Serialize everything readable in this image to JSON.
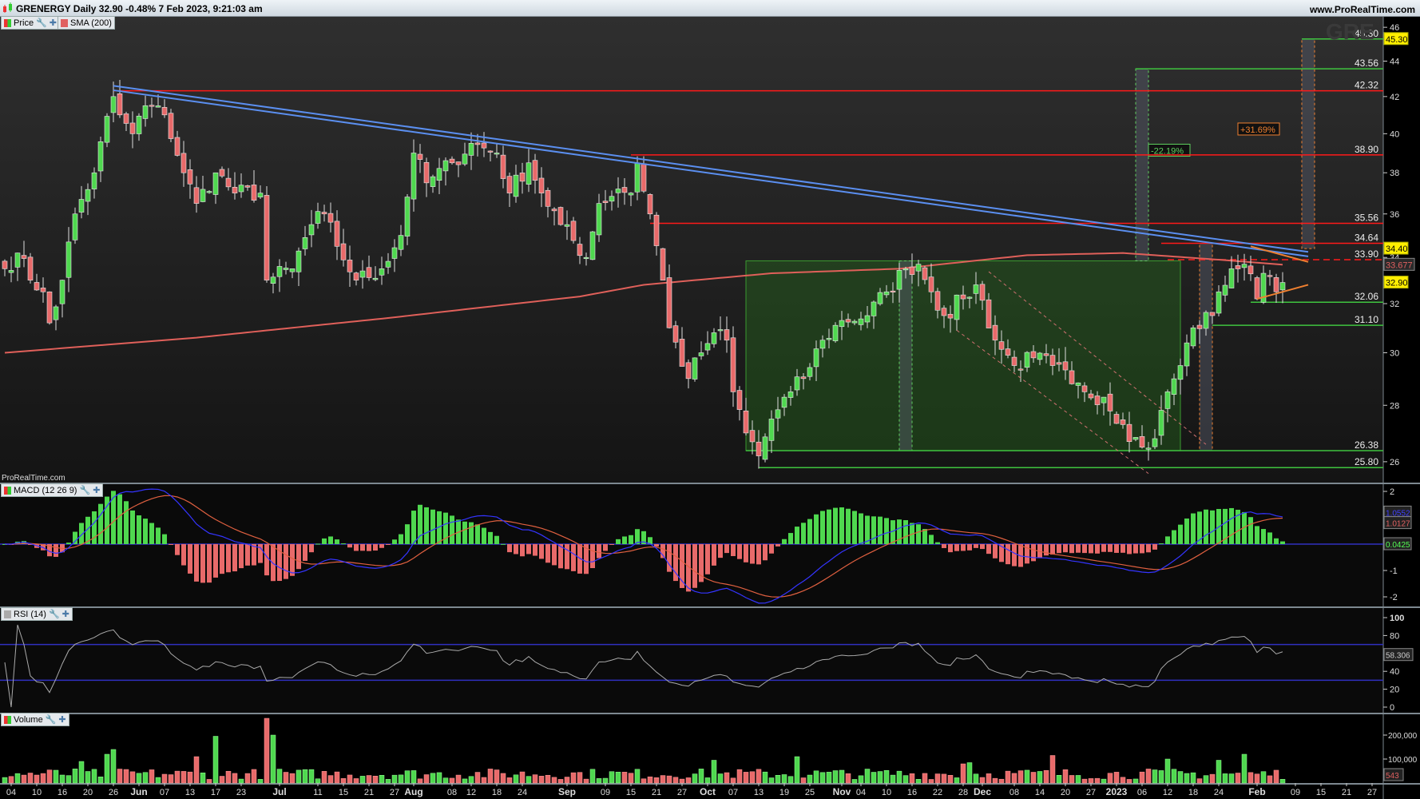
{
  "header": {
    "title": "GRENERGY Daily 32.90 -0.48% 7 Feb 2023, 9:21:03 am",
    "website": "www.ProRealTime.com"
  },
  "legends": {
    "price": "Price",
    "sma": "SMA (200)",
    "macd": "MACD (12 26 9)",
    "rsi": "RSI (14)",
    "volume": "Volume"
  },
  "watermark": "GRE",
  "brand_footer": "ProRealTime.com",
  "colors": {
    "up": "#4fd84f",
    "down": "#e86a6a",
    "sma": "#e0605a",
    "trend": "#5b8ff0",
    "hline_red": "#ff1a1a",
    "hline_green": "#3fc43f",
    "orange": "#f08030",
    "macd": "#3434ff",
    "signal": "#e06040"
  },
  "chart_data": {
    "type": "candlestick",
    "title": "GRENERGY Daily",
    "scale": "log",
    "ylim": [
      25.5,
      46.5
    ],
    "y_ticks": [
      "46",
      "44",
      "42",
      "40",
      "38",
      "36",
      "34",
      "32",
      "30",
      "28",
      "26"
    ],
    "close_keypoints": [
      [
        0,
        33.5
      ],
      [
        2,
        34.2
      ],
      [
        4,
        33.0
      ],
      [
        6,
        32.5
      ],
      [
        7,
        31.2
      ],
      [
        9,
        33.0
      ],
      [
        11,
        36.0
      ],
      [
        14,
        38.0
      ],
      [
        17,
        42.0
      ],
      [
        18,
        41.0
      ],
      [
        20,
        40.0
      ],
      [
        22,
        41.5
      ],
      [
        25,
        41.0
      ],
      [
        28,
        38.0
      ],
      [
        30,
        36.5
      ],
      [
        33,
        38.0
      ],
      [
        36,
        37.0
      ],
      [
        40,
        37.0
      ],
      [
        41,
        33.0
      ],
      [
        45,
        33.5
      ],
      [
        48,
        35.5
      ],
      [
        50,
        36.0
      ],
      [
        52,
        34.5
      ],
      [
        55,
        33.0
      ],
      [
        59,
        33.5
      ],
      [
        62,
        35.0
      ],
      [
        64,
        39.0
      ],
      [
        66,
        37.5
      ],
      [
        70,
        38.5
      ],
      [
        73,
        39.5
      ],
      [
        77,
        39.0
      ],
      [
        79,
        37.0
      ],
      [
        82,
        38.5
      ],
      [
        84,
        37.0
      ],
      [
        87,
        35.5
      ],
      [
        91,
        34.0
      ],
      [
        93,
        36.5
      ],
      [
        96,
        37.2
      ],
      [
        98,
        37.0
      ],
      [
        99,
        38.5
      ],
      [
        101,
        36.0
      ],
      [
        103,
        33.0
      ],
      [
        104,
        31.0
      ],
      [
        107,
        29.0
      ],
      [
        109,
        30.0
      ],
      [
        111,
        30.8
      ],
      [
        113,
        30.5
      ],
      [
        114,
        28.5
      ],
      [
        116,
        27.0
      ],
      [
        118,
        26.2
      ],
      [
        120,
        27.5
      ],
      [
        123,
        28.5
      ],
      [
        125,
        29.0
      ],
      [
        128,
        30.5
      ],
      [
        131,
        31.3
      ],
      [
        135,
        31.5
      ],
      [
        138,
        32.5
      ],
      [
        141,
        33.5
      ],
      [
        143,
        33.7
      ],
      [
        145,
        32.5
      ],
      [
        147,
        31.5
      ],
      [
        150,
        32.2
      ],
      [
        152,
        32.8
      ],
      [
        155,
        30.5
      ],
      [
        158,
        29.5
      ],
      [
        161,
        29.8
      ],
      [
        164,
        29.5
      ],
      [
        167,
        28.8
      ],
      [
        169,
        28.5
      ],
      [
        172,
        28.3
      ],
      [
        175,
        27.3
      ],
      [
        178,
        26.5
      ],
      [
        180,
        26.8
      ],
      [
        182,
        28.5
      ],
      [
        184,
        29.5
      ],
      [
        186,
        31.0
      ],
      [
        189,
        31.5
      ],
      [
        190,
        32.5
      ],
      [
        192,
        33.5
      ],
      [
        194,
        33.7
      ],
      [
        196,
        32.2
      ],
      [
        197,
        33.3
      ],
      [
        198,
        33.2
      ],
      [
        199,
        32.5
      ],
      [
        200,
        32.9
      ]
    ],
    "sma200_keypoints": [
      [
        0,
        30.0
      ],
      [
        30,
        30.6
      ],
      [
        60,
        31.4
      ],
      [
        90,
        32.3
      ],
      [
        100,
        32.8
      ],
      [
        120,
        33.3
      ],
      [
        140,
        33.5
      ],
      [
        160,
        34.1
      ],
      [
        175,
        34.2
      ],
      [
        190,
        33.9
      ],
      [
        200,
        33.68
      ]
    ],
    "x_labels": [
      {
        "i": 1,
        "t": "04"
      },
      {
        "i": 5,
        "t": "10"
      },
      {
        "i": 9,
        "t": "16"
      },
      {
        "i": 13,
        "t": "20"
      },
      {
        "i": 17,
        "t": "26"
      },
      {
        "i": 21,
        "t": "Jun",
        "b": 1
      },
      {
        "i": 25,
        "t": "07"
      },
      {
        "i": 29,
        "t": "13"
      },
      {
        "i": 33,
        "t": "17"
      },
      {
        "i": 37,
        "t": "23"
      },
      {
        "i": 43,
        "t": "Jul",
        "b": 1
      },
      {
        "i": 49,
        "t": "11"
      },
      {
        "i": 53,
        "t": "15"
      },
      {
        "i": 57,
        "t": "21"
      },
      {
        "i": 61,
        "t": "27"
      },
      {
        "i": 64,
        "t": "Aug",
        "b": 1
      },
      {
        "i": 70,
        "t": "08"
      },
      {
        "i": 73,
        "t": "12"
      },
      {
        "i": 77,
        "t": "18"
      },
      {
        "i": 81,
        "t": "24"
      },
      {
        "i": 88,
        "t": "Sep",
        "b": 1
      },
      {
        "i": 94,
        "t": "09"
      },
      {
        "i": 98,
        "t": "15"
      },
      {
        "i": 102,
        "t": "21"
      },
      {
        "i": 106,
        "t": "27"
      },
      {
        "i": 110,
        "t": "Oct",
        "b": 1
      },
      {
        "i": 114,
        "t": "07"
      },
      {
        "i": 118,
        "t": "13"
      },
      {
        "i": 122,
        "t": "19"
      },
      {
        "i": 126,
        "t": "25"
      },
      {
        "i": 131,
        "t": "Nov",
        "b": 1
      },
      {
        "i": 134,
        "t": "04"
      },
      {
        "i": 138,
        "t": "10"
      },
      {
        "i": 142,
        "t": "16"
      },
      {
        "i": 146,
        "t": "22"
      },
      {
        "i": 150,
        "t": "28"
      },
      {
        "i": 153,
        "t": "Dec",
        "b": 1
      },
      {
        "i": 158,
        "t": "08"
      },
      {
        "i": 162,
        "t": "14"
      },
      {
        "i": 166,
        "t": "20"
      },
      {
        "i": 170,
        "t": "27"
      },
      {
        "i": 174,
        "t": "2023",
        "b": 1
      },
      {
        "i": 178,
        "t": "06"
      },
      {
        "i": 182,
        "t": "12"
      },
      {
        "i": 186,
        "t": "18"
      },
      {
        "i": 190,
        "t": "24"
      },
      {
        "i": 196,
        "t": "Feb",
        "b": 1
      },
      {
        "i": 202,
        "t": "09"
      },
      {
        "i": 206,
        "t": "15"
      },
      {
        "i": 210,
        "t": "21"
      },
      {
        "i": 214,
        "t": "27"
      }
    ],
    "hlines": [
      {
        "price": 45.3,
        "label": "45.30",
        "color": "green",
        "from": 203
      },
      {
        "price": 43.56,
        "label": "43.56",
        "color": "green",
        "from": 177
      },
      {
        "price": 42.32,
        "label": "42.32",
        "color": "red",
        "from": 17
      },
      {
        "price": 38.9,
        "label": "38.90",
        "color": "red",
        "from": 98
      },
      {
        "price": 35.56,
        "label": "35.56",
        "color": "red",
        "from": 101
      },
      {
        "price": 34.64,
        "label": "34.64",
        "color": "red",
        "from": 181
      },
      {
        "price": 33.9,
        "label": "33.90",
        "color": "red",
        "from": 182,
        "dashed": true
      },
      {
        "price": 32.06,
        "label": "32.06",
        "color": "green",
        "from": 195
      },
      {
        "price": 31.1,
        "label": "31.10",
        "color": "green",
        "from": 189
      },
      {
        "price": 26.38,
        "label": "26.38",
        "color": "green",
        "from": 116
      },
      {
        "price": 25.8,
        "label": "25.80",
        "color": "green",
        "from": 118
      }
    ],
    "trendlines": [
      {
        "from": [
          17,
          42.6
        ],
        "to": [
          204,
          34.25
        ],
        "color": "trend"
      },
      {
        "from": [
          17,
          42.35
        ],
        "to": [
          204,
          34.05
        ],
        "color": "trend"
      },
      {
        "from": [
          195,
          34.5
        ],
        "to": [
          204,
          33.8
        ],
        "color": "orange"
      },
      {
        "from": [
          196,
          32.2
        ],
        "to": [
          204,
          32.8
        ],
        "color": "orange"
      },
      {
        "from": [
          154,
          33.37
        ],
        "to": [
          188,
          26.6
        ],
        "color": "pink",
        "dashed": true
      },
      {
        "from": [
          149,
          30.9
        ],
        "to": [
          179,
          25.6
        ],
        "color": "pink",
        "dashed": true
      }
    ],
    "zone": {
      "from": 116,
      "to": 184,
      "top": 33.85,
      "bottom": 26.38
    },
    "measures": [
      {
        "from": 177,
        "to": 179,
        "top": 43.56,
        "bottom": 33.85,
        "label": "-22.19%",
        "color": "green",
        "label_i": 179,
        "label_price": 39.0
      },
      {
        "from": 140,
        "to": 142,
        "top": 33.85,
        "bottom": 26.38,
        "color": "green"
      },
      {
        "from": 187,
        "to": 189,
        "top": 34.64,
        "bottom": 26.38,
        "color": "orange"
      },
      {
        "from": 203,
        "to": 205,
        "top": 45.3,
        "bottom": 34.4,
        "label": "+31.69%",
        "color": "orange",
        "label_i": 193,
        "label_price": 40.1
      }
    ],
    "price_tags": [
      {
        "label": "45.30",
        "price": 45.3,
        "style": "yellow"
      },
      {
        "label": "34.40",
        "price": 34.4,
        "style": "yellow"
      },
      {
        "label": "33.677",
        "price": 33.677,
        "style": "sma"
      },
      {
        "label": "32.90",
        "price": 32.9,
        "style": "yellow"
      }
    ],
    "macd": {
      "fast": 12,
      "slow": 26,
      "signal": 9,
      "ticks": [
        "2",
        "-1",
        "-2"
      ],
      "tag_macd": "1.0552",
      "tag_signal": "1.0127",
      "tag_hist": "0.0425"
    },
    "rsi": {
      "period": 14,
      "ticks": [
        "100",
        "80",
        "40",
        "20",
        "0"
      ],
      "levels": [
        70,
        30
      ],
      "tag": "58.306"
    },
    "volume": {
      "ticks": [
        "200,000",
        "100,000"
      ],
      "tag": "543",
      "spikes": [
        [
          12,
          90000
        ],
        [
          16,
          120000
        ],
        [
          17,
          140000
        ],
        [
          30,
          110000
        ],
        [
          33,
          195000
        ],
        [
          41,
          270000
        ],
        [
          42,
          200000
        ],
        [
          111,
          95000
        ],
        [
          124,
          110000
        ],
        [
          150,
          80000
        ],
        [
          151,
          85000
        ],
        [
          164,
          115000
        ],
        [
          182,
          100000
        ],
        [
          190,
          95000
        ],
        [
          194,
          120000
        ]
      ]
    }
  }
}
